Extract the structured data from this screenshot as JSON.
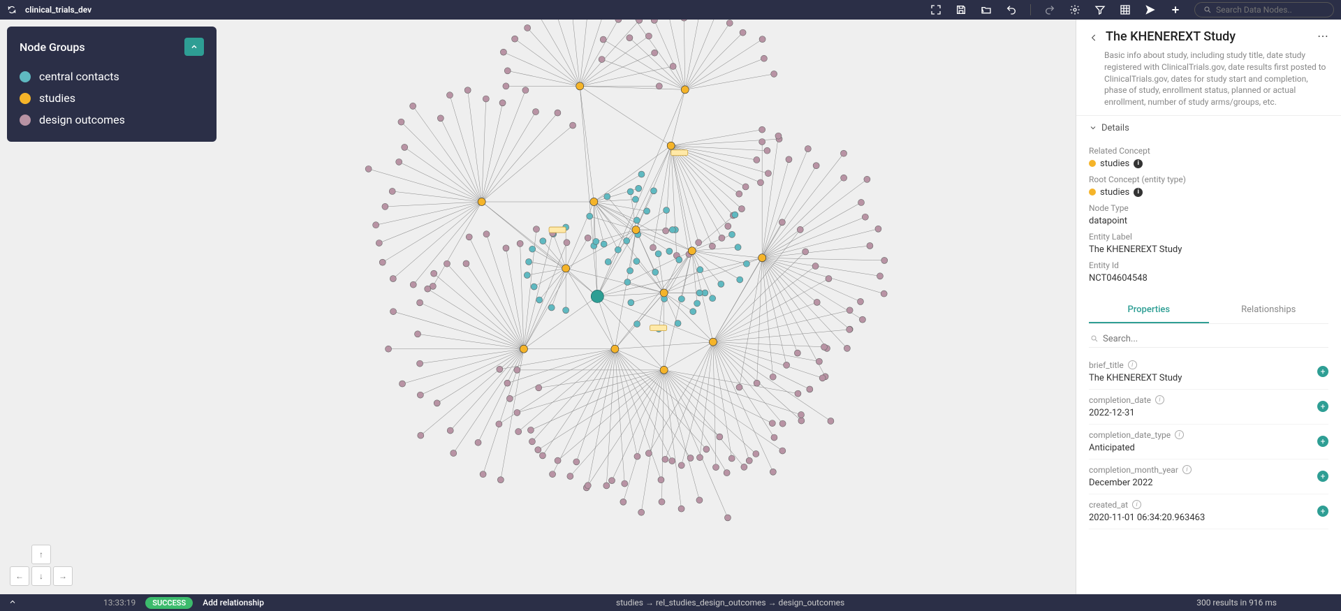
{
  "topbar": {
    "title": "clinical_trials_dev",
    "search_placeholder": "Search Data Nodes.."
  },
  "legend": {
    "title": "Node Groups",
    "items": [
      {
        "label": "central contacts",
        "color": "#5fb9c1"
      },
      {
        "label": "studies",
        "color": "#f5b429"
      },
      {
        "label": "design outcomes",
        "color": "#b893a4"
      }
    ]
  },
  "sidebar": {
    "title": "The KHENEREXT Study",
    "description": "Basic info about study, including study title, date study registered with ClinicalTrials.gov, date results first posted to ClinicalTrials.gov, dates for study start and completion, phase of study, enrollment status, planned or actual enrollment, number of study arms/groups, etc.",
    "details_header": "Details",
    "details": {
      "related_concept_label": "Related Concept",
      "related_concept_value": "studies",
      "root_concept_label": "Root Concept (entity type)",
      "root_concept_value": "studies",
      "node_type_label": "Node Type",
      "node_type_value": "datapoint",
      "entity_label_label": "Entity Label",
      "entity_label_value": "The KHENEREXT Study",
      "entity_id_label": "Entity Id",
      "entity_id_value": "NCT04604548"
    },
    "tabs": {
      "properties": "Properties",
      "relationships": "Relationships"
    },
    "prop_search_placeholder": "Search...",
    "properties": [
      {
        "key": "brief_title",
        "value": "The KHENEREXT Study"
      },
      {
        "key": "completion_date",
        "value": "2022-12-31"
      },
      {
        "key": "completion_date_type",
        "value": "Anticipated"
      },
      {
        "key": "completion_month_year",
        "value": "December 2022"
      },
      {
        "key": "created_at",
        "value": "2020-11-01 06:34:20.963463"
      }
    ]
  },
  "bottombar": {
    "time": "13:33:19",
    "status": "SUCCESS",
    "action": "Add relationship",
    "path": "studies → rel_studies_design_outcomes → design_outcomes",
    "results": "300 results in 916 ms"
  },
  "colors": {
    "central": "#5fb9c1",
    "studies": "#f5b429",
    "design": "#b893a4",
    "hub": "#2e9e94"
  }
}
